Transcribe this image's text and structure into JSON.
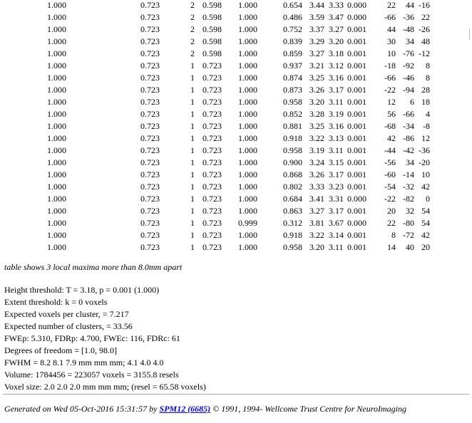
{
  "table_rows": [
    [
      "1.000",
      "0.723",
      "2",
      "0.598",
      "1.000",
      "0.654",
      "3.44",
      "3.33",
      "0.000",
      "22",
      "44",
      "-16"
    ],
    [
      "1.000",
      "0.723",
      "2",
      "0.598",
      "1.000",
      "0.486",
      "3.59",
      "3.47",
      "0.000",
      "-66",
      "-36",
      "22"
    ],
    [
      "1.000",
      "0.723",
      "2",
      "0.598",
      "1.000",
      "0.752",
      "3.37",
      "3.27",
      "0.001",
      "44",
      "-48",
      "-26"
    ],
    [
      "1.000",
      "0.723",
      "2",
      "0.598",
      "1.000",
      "0.839",
      "3.29",
      "3.20",
      "0.001",
      "30",
      "34",
      "48"
    ],
    [
      "1.000",
      "0.723",
      "2",
      "0.598",
      "1.000",
      "0.859",
      "3.27",
      "3.18",
      "0.001",
      "10",
      "-76",
      "-12"
    ],
    [
      "1.000",
      "0.723",
      "1",
      "0.723",
      "1.000",
      "0.937",
      "3.21",
      "3.12",
      "0.001",
      "-18",
      "-92",
      "8"
    ],
    [
      "1.000",
      "0.723",
      "1",
      "0.723",
      "1.000",
      "0.874",
      "3.25",
      "3.16",
      "0.001",
      "-66",
      "-46",
      "8"
    ],
    [
      "1.000",
      "0.723",
      "1",
      "0.723",
      "1.000",
      "0.873",
      "3.26",
      "3.17",
      "0.001",
      "-22",
      "-94",
      "28"
    ],
    [
      "1.000",
      "0.723",
      "1",
      "0.723",
      "1.000",
      "0.958",
      "3.20",
      "3.11",
      "0.001",
      "12",
      "6",
      "18"
    ],
    [
      "1.000",
      "0.723",
      "1",
      "0.723",
      "1.000",
      "0.852",
      "3.28",
      "3.19",
      "0.001",
      "56",
      "-66",
      "4"
    ],
    [
      "1.000",
      "0.723",
      "1",
      "0.723",
      "1.000",
      "0.881",
      "3.25",
      "3.16",
      "0.001",
      "-68",
      "-34",
      "-8"
    ],
    [
      "1.000",
      "0.723",
      "1",
      "0.723",
      "1.000",
      "0.918",
      "3.22",
      "3.13",
      "0.001",
      "42",
      "-86",
      "12"
    ],
    [
      "1.000",
      "0.723",
      "1",
      "0.723",
      "1.000",
      "0.958",
      "3.19",
      "3.11",
      "0.001",
      "-44",
      "-42",
      "-36"
    ],
    [
      "1.000",
      "0.723",
      "1",
      "0.723",
      "1.000",
      "0.900",
      "3.24",
      "3.15",
      "0.001",
      "-56",
      "34",
      "-20"
    ],
    [
      "1.000",
      "0.723",
      "1",
      "0.723",
      "1.000",
      "0.868",
      "3.26",
      "3.17",
      "0.001",
      "-60",
      "-14",
      "10"
    ],
    [
      "1.000",
      "0.723",
      "1",
      "0.723",
      "1.000",
      "0.802",
      "3.33",
      "3.23",
      "0.001",
      "-54",
      "-32",
      "42"
    ],
    [
      "1.000",
      "0.723",
      "1",
      "0.723",
      "1.000",
      "0.684",
      "3.41",
      "3.31",
      "0.000",
      "-22",
      "-82",
      "0"
    ],
    [
      "1.000",
      "0.723",
      "1",
      "0.723",
      "1.000",
      "0.863",
      "3.27",
      "3.17",
      "0.001",
      "20",
      "32",
      "54"
    ],
    [
      "1.000",
      "0.723",
      "1",
      "0.723",
      "0.999",
      "0.312",
      "3.81",
      "3.67",
      "0.000",
      "22",
      "-80",
      "54"
    ],
    [
      "1.000",
      "0.723",
      "1",
      "0.723",
      "1.000",
      "0.918",
      "3.22",
      "3.14",
      "0.001",
      "8",
      "-72",
      "42"
    ],
    [
      "1.000",
      "0.723",
      "1",
      "0.723",
      "1.000",
      "0.958",
      "3.20",
      "3.11",
      "0.001",
      "14",
      "40",
      "20"
    ]
  ],
  "note": "table shows 3 local maxima more than 8.0mm apart",
  "info_lines": [
    "Height threshold: T = 3.18, p = 0.001 (1.000)",
    "Extent threshold: k = 0 voxels",
    "Expected voxels per cluster, = 7.217",
    "Expected number of clusters, = 33.56",
    "FWEp: 5.310, FDRp: 4.700, FWEc: 116, FDRc: 61",
    "Degrees of freedom = [1.0, 98.0]",
    "FWHM = 8.2 8.1 7.9 mm mm mm; 4.1 4.0 4.0",
    "Volume: 1784456 = 223057 voxels = 3155.8 resels",
    "Voxel size: 2.0 2.0 2.0 mm mm mm; (resel = 65.58 voxels)"
  ],
  "footer": {
    "prefix": "Generated on Wed 05-Oct-2016 15:31:57 by ",
    "link_text": "SPM12 (6685)",
    "suffix": " © 1991, 1994- Wellcome Trust Centre for NeuroImaging"
  }
}
